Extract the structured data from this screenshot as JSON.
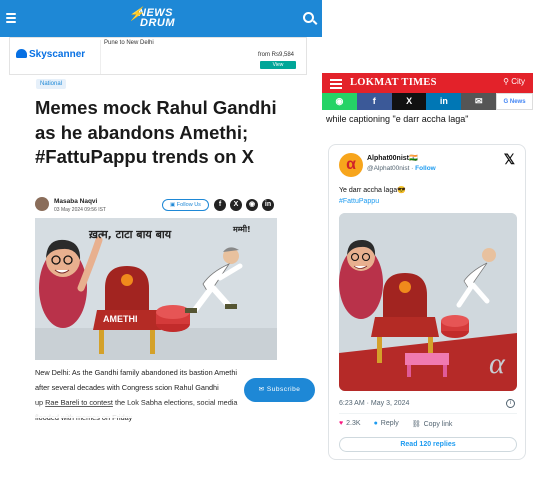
{
  "newsdrum": {
    "logo_line1": "NEWS",
    "logo_line2": "DRUM",
    "ad": {
      "brand": "Skyscanner",
      "route": "Pune to New Delhi",
      "price": "from Rs9,584",
      "cta": "View"
    },
    "tag": "National",
    "headline": "Memes mock Rahul Gandhi as he abandons Amethi; #FattuPappu trends on X",
    "author": "Masaba Naqvi",
    "date": "03 May 2024 09:56 IST",
    "follow_label": "Follow Us",
    "cartoon_text_top": "ख़त्म, टाटा बाय बाय",
    "cartoon_text_run": "मम्मी!",
    "cartoon_chair_label": "AMETHI",
    "article": {
      "line1": "New Delhi: As the Gandhi family abandoned its bastion Amethi",
      "line2": "after several decades with Congress scion Rahul Gandhi",
      "line3_prefix": "up",
      "line3_link": "Rae Bareli to contest",
      "line3_suffix": "the Lok Sabha elections, social media",
      "line4": "flooded with memes on Friday"
    },
    "subscribe_label": "Subscribe"
  },
  "lokmat": {
    "title": "LOKMAT TIMES",
    "city": "City",
    "caption": "while captioning \"e darr accha laga\"",
    "tweet": {
      "name": "Alphat00nist🇮🇳",
      "handle": "@Alphat00nist",
      "follow": "Follow",
      "text": "Ye darr accha laga😎",
      "hashtag": "#FattuPappu",
      "time": "6:23 AM · May 3, 2024",
      "likes": "2.3K",
      "reply": "Reply",
      "copy_link": "Copy link",
      "read_replies": "Read 120 replies"
    }
  },
  "colors": {
    "newsdrum_blue": "#1e88d6",
    "lokmat_red": "#e3222a",
    "twitter_blue": "#1d9bf0"
  }
}
